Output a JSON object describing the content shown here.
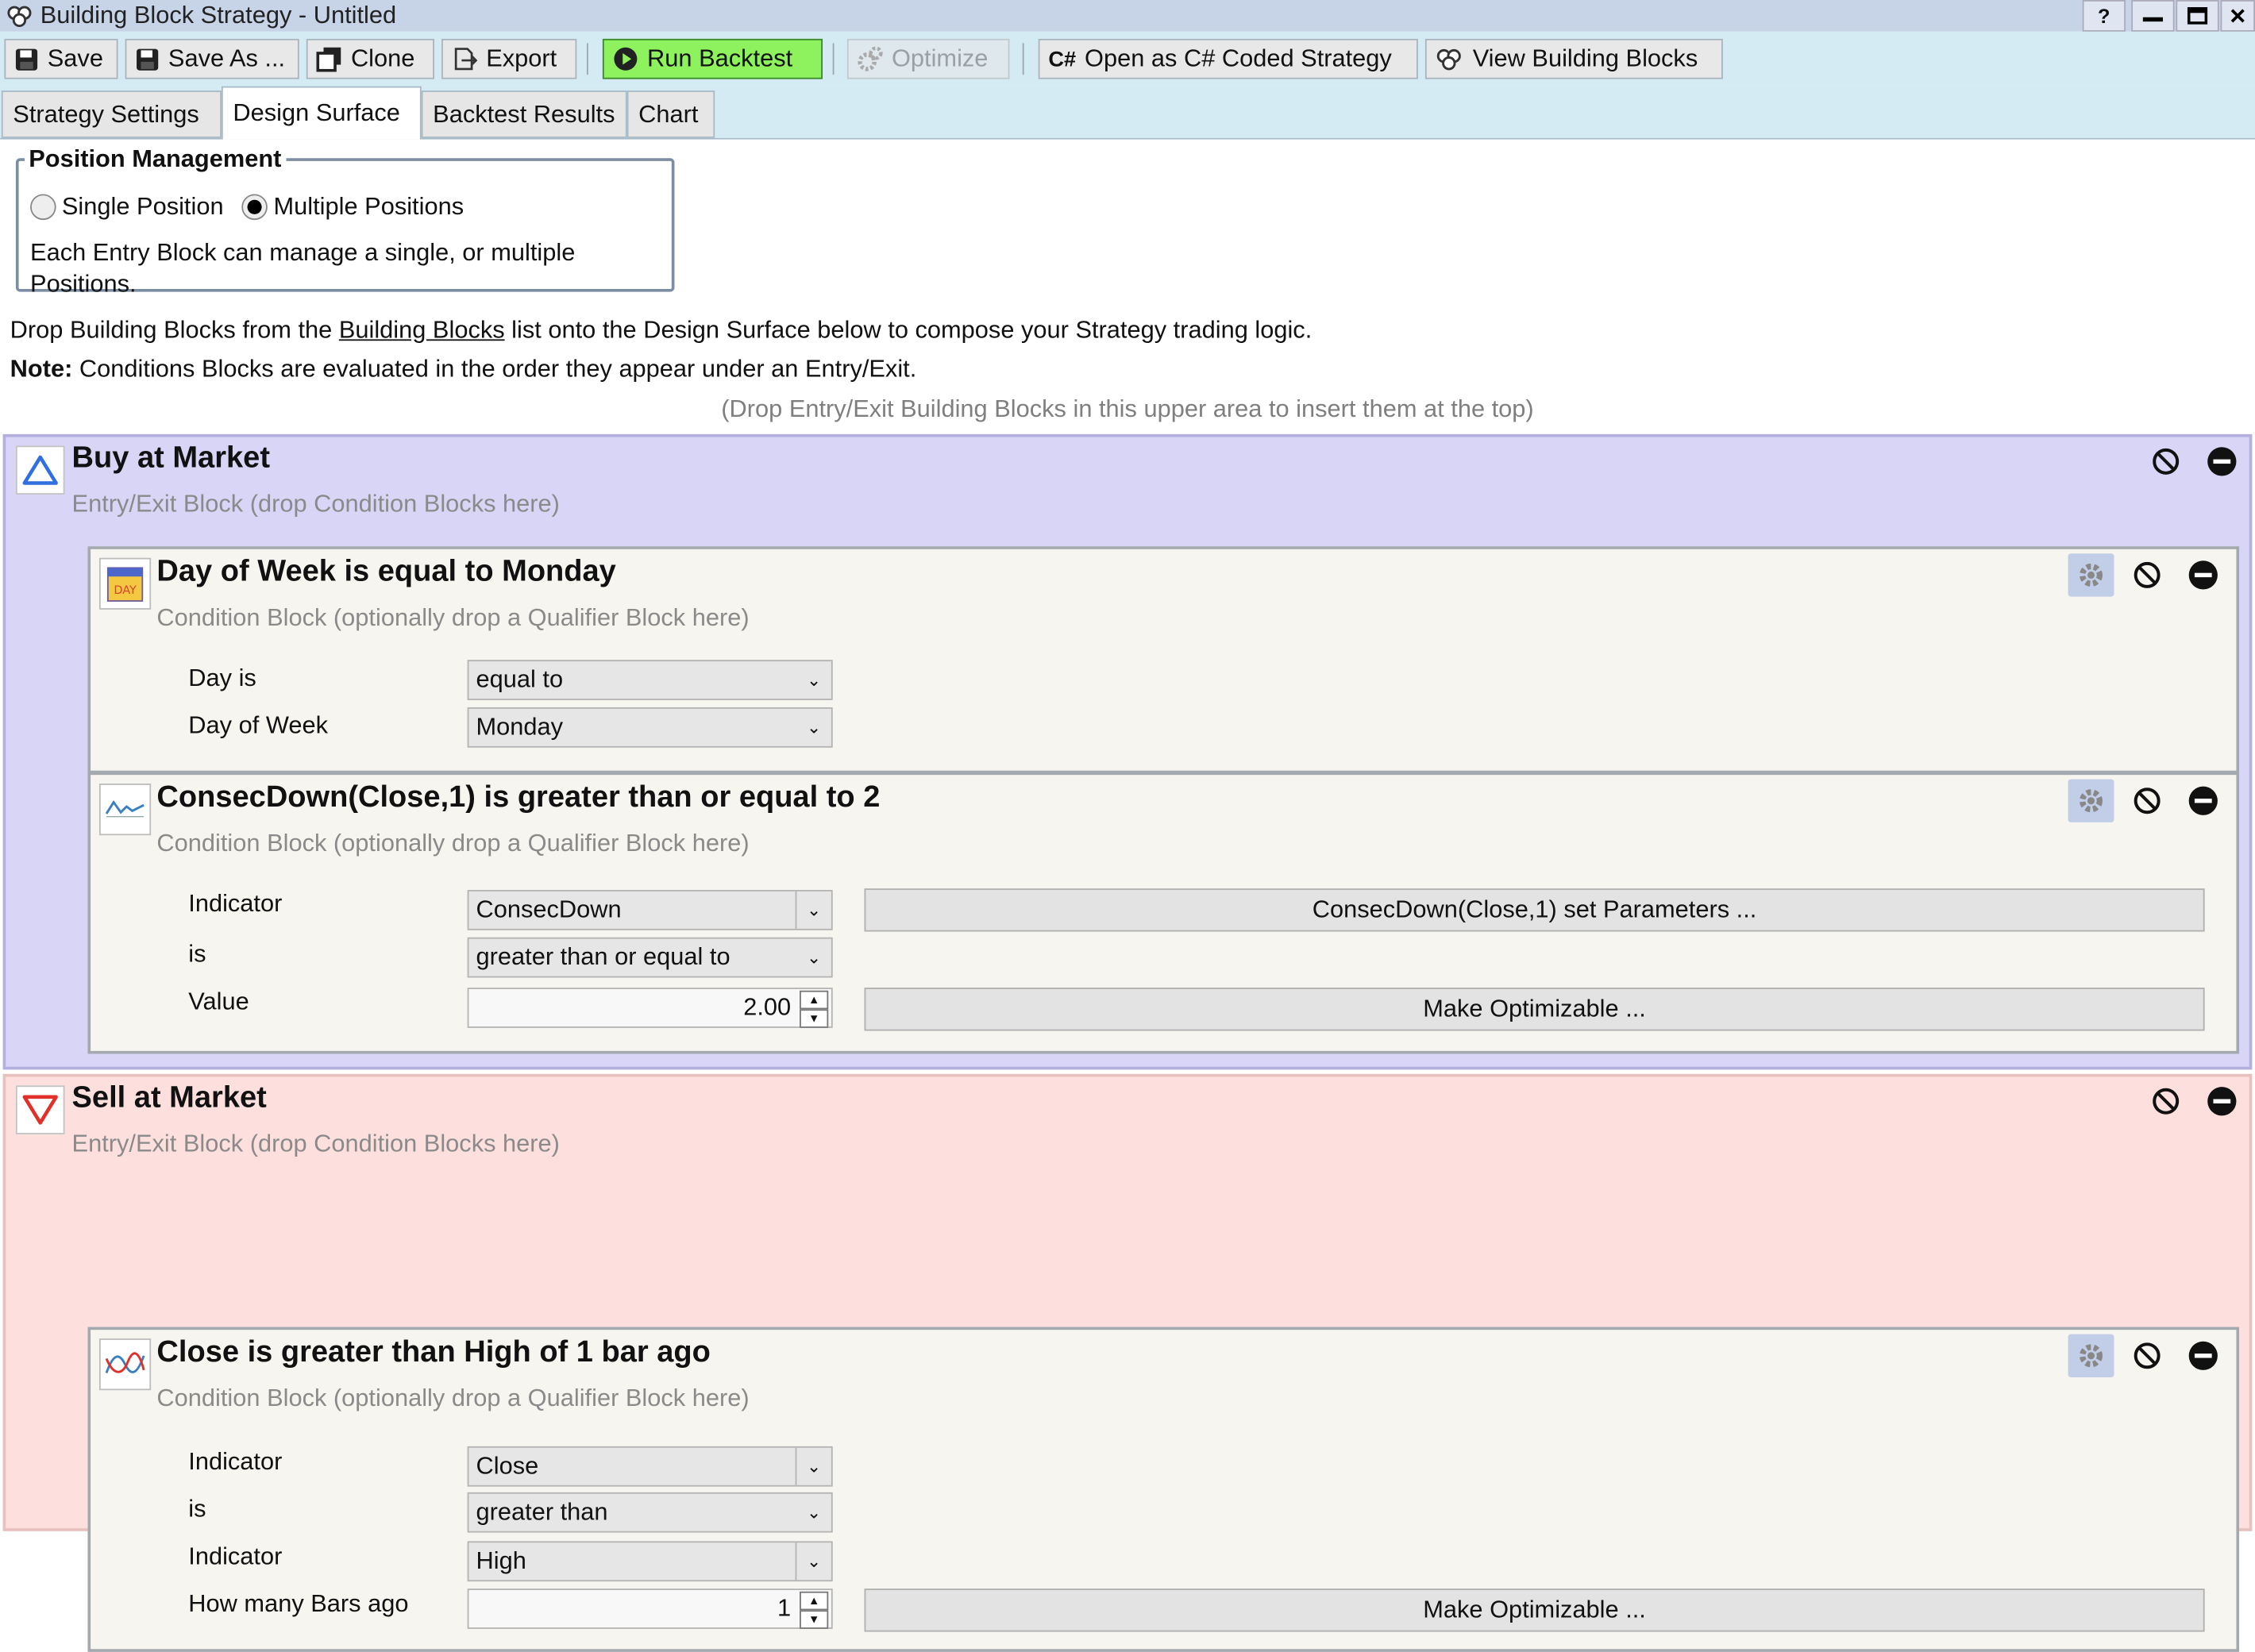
{
  "window": {
    "title": "Building Block Strategy - Untitled",
    "controls": {
      "help": "?"
    }
  },
  "toolbar": {
    "save": "Save",
    "save_as": "Save As ...",
    "clone": "Clone",
    "export": "Export",
    "run_backtest": "Run Backtest",
    "optimize": "Optimize",
    "open_csharp": "Open as C# Coded Strategy",
    "view_blocks": "View Building Blocks",
    "colors": {
      "run_backtest_bg": "#8ef25e"
    }
  },
  "tabs": [
    {
      "label": "Strategy Settings",
      "active": false
    },
    {
      "label": "Design Surface",
      "active": true
    },
    {
      "label": "Backtest Results",
      "active": false
    },
    {
      "label": "Chart",
      "active": false
    }
  ],
  "position_management": {
    "legend": "Position Management",
    "options": [
      "Single Position",
      "Multiple Positions"
    ],
    "selected": "Multiple Positions",
    "help_line1": "Each Entry Block can manage a single, or multiple",
    "help_line2": "Positions."
  },
  "instructions": {
    "line1_before": "Drop Building Blocks from the ",
    "line1_link": "Building Blocks",
    "line1_after": " list onto the Design Surface below to compose your Strategy trading logic.",
    "note_label": "Note:",
    "note_text": " Conditions Blocks are evaluated in the order they appear under an Entry/Exit.",
    "drop_hint": "(Drop Entry/Exit Building Blocks in this upper area to insert them at the top)"
  },
  "buy_block": {
    "title": "Buy at Market",
    "subtitle": "Entry/Exit Block (drop Condition Blocks here)",
    "color": "#d8d5f7",
    "conditions": [
      {
        "title": "Day of Week is equal to Monday",
        "subtitle": "Condition Block (optionally drop a Qualifier Block here)",
        "params": [
          {
            "label": "Day is",
            "value": "equal to"
          },
          {
            "label": "Day of Week",
            "value": "Monday"
          }
        ]
      },
      {
        "title": "ConsecDown(Close,1) is greater than or equal to 2",
        "subtitle": "Condition Block (optionally drop a Qualifier Block here)",
        "indicator_label": "Indicator",
        "indicator_value": "ConsecDown",
        "set_params_button": "ConsecDown(Close,1) set Parameters ...",
        "is_label": "is",
        "is_value": "greater than or equal to",
        "value_label": "Value",
        "value": "2.00",
        "make_optimizable": "Make Optimizable ..."
      }
    ]
  },
  "sell_block": {
    "title": "Sell at Market",
    "subtitle": "Entry/Exit Block (drop Condition Blocks here)",
    "color": "#fde0dd",
    "conditions": [
      {
        "title": "Close is greater than High of 1 bar ago",
        "subtitle": "Condition Block (optionally drop a Qualifier Block here)",
        "indicator_label": "Indicator",
        "indicator_value": "Close",
        "is_label": "is",
        "is_value": "greater than",
        "indicator2_label": "Indicator",
        "indicator2_value": "High",
        "bars_ago_label": "How many Bars ago",
        "bars_ago_value": "1",
        "make_optimizable": "Make Optimizable ..."
      }
    ]
  },
  "icons": {
    "cs_glyph": "C#",
    "day_glyph": "DAY"
  }
}
